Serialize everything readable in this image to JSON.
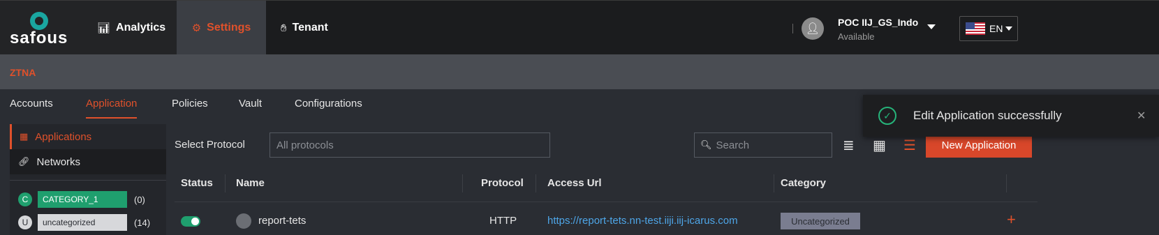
{
  "header": {
    "brand": "safous",
    "nav": [
      {
        "label": "Analytics",
        "icon": "bar-chart-icon"
      },
      {
        "label": "Settings",
        "icon": "gear-icon"
      },
      {
        "label": "Tenant",
        "icon": "hand-icon"
      }
    ],
    "user": {
      "name": "POC IIJ_GS_Indo",
      "status": "Available"
    },
    "language": "EN"
  },
  "section_title": "ZTNA",
  "tabs": [
    {
      "label": "Accounts"
    },
    {
      "label": "Application"
    },
    {
      "label": "Policies"
    },
    {
      "label": "Vault"
    },
    {
      "label": "Configurations"
    }
  ],
  "sidebar": {
    "items": [
      {
        "label": "Applications",
        "icon": "grid-icon"
      },
      {
        "label": "Networks",
        "icon": "link-icon"
      }
    ],
    "categories": [
      {
        "initial": "C",
        "name": "CATEGORY_1",
        "count": "(0)",
        "color": "#1f9f6e"
      },
      {
        "initial": "U",
        "name": "uncategorized",
        "count": "(14)",
        "color": "#d7d8db"
      }
    ]
  },
  "toolbar": {
    "protocol_label": "Select Protocol",
    "protocol_placeholder": "All protocols",
    "search_placeholder": "Search",
    "new_button": "New Application"
  },
  "table": {
    "columns": [
      "Status",
      "Name",
      "Protocol",
      "Access Url",
      "Category"
    ],
    "rows": [
      {
        "enabled": true,
        "name": "report-tets",
        "protocol": "HTTP",
        "url": "https://report-tets.nn-test.iiji.iij-icarus.com",
        "category": "Uncategorized"
      }
    ]
  },
  "toast": {
    "message": "Edit Application successfully"
  },
  "colors": {
    "accent": "#e0512b",
    "success": "#26b47a",
    "link": "#4ea6e8"
  }
}
